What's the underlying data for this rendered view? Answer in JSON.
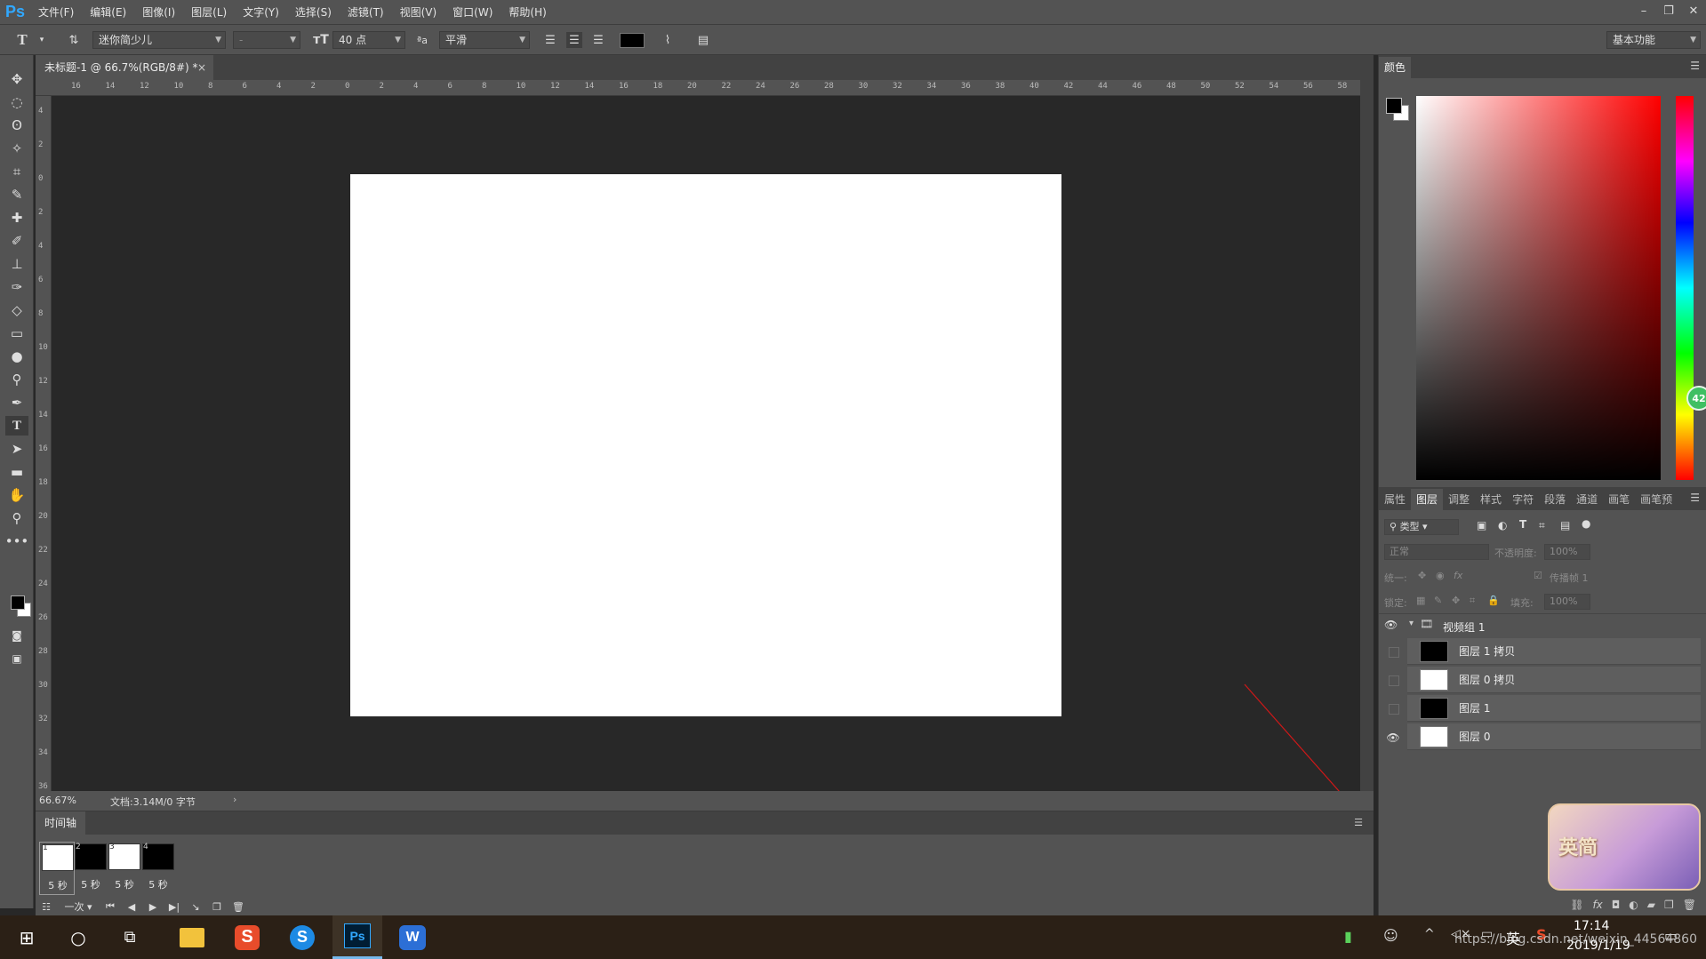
{
  "app": {
    "logo": "Ps",
    "menu": [
      "文件(F)",
      "编辑(E)",
      "图像(I)",
      "图层(L)",
      "文字(Y)",
      "选择(S)",
      "滤镜(T)",
      "视图(V)",
      "窗口(W)",
      "帮助(H)"
    ],
    "window_controls": [
      "minimize-icon",
      "restore-icon",
      "close-icon"
    ]
  },
  "options_bar": {
    "tool_glyph": "T",
    "font_family": "迷你简少儿",
    "font_style": "-",
    "font_size": "40 点",
    "anti_alias": "平滑",
    "text_color": "#000000",
    "workspace": "基本功能"
  },
  "document": {
    "tab_title": "未标题-1 @ 66.7%(RGB/8#) *",
    "zoom": "66.67%",
    "doc_info": "文档:3.14M/0 字节",
    "ruler_top": [
      "16",
      "14",
      "12",
      "10",
      "8",
      "6",
      "4",
      "2",
      "0",
      "2",
      "4",
      "6",
      "8",
      "10",
      "12",
      "14",
      "16",
      "18",
      "20",
      "22",
      "24",
      "26",
      "28",
      "30",
      "32",
      "34",
      "36",
      "38",
      "40",
      "42",
      "44",
      "46",
      "48",
      "50",
      "52",
      "54",
      "56",
      "58"
    ],
    "ruler_left": [
      "4",
      "2",
      "0",
      "2",
      "4",
      "6",
      "8",
      "10",
      "12",
      "14",
      "16",
      "18",
      "20",
      "22",
      "24",
      "26",
      "28",
      "30",
      "32",
      "34",
      "36"
    ]
  },
  "timeline": {
    "title": "时间轴",
    "frames": [
      {
        "num": "1",
        "color": "#ffffff",
        "duration": "5 秒",
        "selected": true
      },
      {
        "num": "2",
        "color": "#000000",
        "duration": "5 秒",
        "selected": false
      },
      {
        "num": "3",
        "color": "#ffffff",
        "duration": "5 秒",
        "selected": false
      },
      {
        "num": "4",
        "color": "#000000",
        "duration": "5 秒",
        "selected": false
      }
    ],
    "loop": "一次"
  },
  "color_panel": {
    "title": "颜色",
    "fg": "#000000",
    "bg": "#ffffff",
    "badge": "42"
  },
  "layers_panel": {
    "tabs": [
      "属性",
      "图层",
      "调整",
      "样式",
      "字符",
      "段落",
      "通道",
      "画笔",
      "画笔预"
    ],
    "active_tab": "图层",
    "filter_label": "类型",
    "blend_mode": "正常",
    "opacity_label": "不透明度:",
    "opacity_value": "100%",
    "unify_label": "统一:",
    "propagate_label": "传播帧 1",
    "lock_label": "锁定:",
    "fill_label": "填充:",
    "fill_value": "100%",
    "group_name": "视频组 1",
    "layers": [
      {
        "name": "图层 1 拷贝",
        "color": "#000000",
        "visible": false
      },
      {
        "name": "图层 0 拷贝",
        "color": "#ffffff",
        "visible": false
      },
      {
        "name": "图层 1",
        "color": "#000000",
        "visible": false
      },
      {
        "name": "图层 0",
        "color": "#ffffff",
        "visible": true
      }
    ]
  },
  "taskbar": {
    "time": "17:14",
    "date": "2019/1/19",
    "ime": "英",
    "watermark": "https://blog.csdn.net/weixin_44564860",
    "avatar_text": "英简"
  }
}
